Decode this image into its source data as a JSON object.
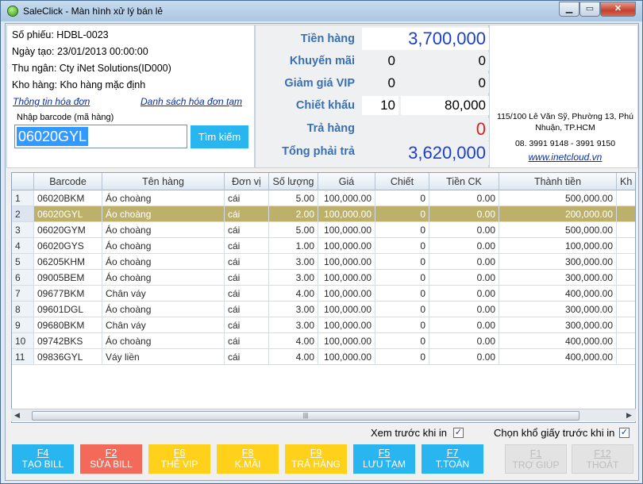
{
  "window": {
    "title": "SaleClick - Màn hình xử lý bán lẻ",
    "min_label": "▁",
    "max_label": "▭",
    "close_label": "✕"
  },
  "info": {
    "so_phieu": "Số phiếu: HDBL-0023",
    "ngay_tao": "Ngày tạo: 23/01/2013 00:00:00",
    "thu_ngan": "Thu ngân: Cty iNet Solutions(ID000)",
    "kho_hang": "Kho hàng: Kho hàng mặc định",
    "link_thong_tin": "Thông tin hóa đơn",
    "link_danh_sach": "Danh sách hóa đơn tạm",
    "barcode_label": "Nhập barcode (mã hàng)",
    "barcode_value": "06020GYL",
    "search_label": "Tìm kiếm"
  },
  "totals": {
    "tien_hang_label": "Tiền hàng",
    "tien_hang_value": "3,700,000",
    "khuyen_mai_label": "Khuyến mãi",
    "khuyen_mai_pct": "0",
    "khuyen_mai_value": "0",
    "giam_gia_label": "Giảm giá VIP",
    "giam_gia_pct": "0",
    "giam_gia_value": "0",
    "chiet_khau_label": "Chiết khấu",
    "chiet_khau_pct": "10",
    "chiet_khau_value": "80,000",
    "tra_hang_label": "Trả hàng",
    "tra_hang_value": "0",
    "tong_label": "Tổng phải trả",
    "tong_value": "3,620,000"
  },
  "contact": {
    "address": "115/100 Lê Văn Sỹ, Phường 13, Phú Nhuận, TP.HCM",
    "phone": "08. 3991 9148 - 3991 9150",
    "website": "www.inetcloud.vn"
  },
  "colors": {
    "accent": "#29b6f0",
    "selected_row": "#bdb06b",
    "red_button": "#f36a5a",
    "yellow_button": "#ffd11a"
  },
  "grid": {
    "headers": [
      "Barcode",
      "Tên hàng",
      "Đơn vị",
      "Số lượng",
      "Giá",
      "Chiết",
      "Tiền CK",
      "Thành tiền",
      "Kh"
    ],
    "selected_index": 1,
    "rows": [
      {
        "n": "1",
        "barcode": "06020BKM",
        "ten": "Áo choàng",
        "dv": "cái",
        "sl": "5.00",
        "gia": "100,000.00",
        "chiet": "0",
        "tien_ck": "0.00",
        "thanh_tien": "500,000.00"
      },
      {
        "n": "2",
        "barcode": "06020GYL",
        "ten": "Áo choàng",
        "dv": "cái",
        "sl": "2.00",
        "gia": "100,000.00",
        "chiet": "0",
        "tien_ck": "0.00",
        "thanh_tien": "200,000.00"
      },
      {
        "n": "3",
        "barcode": "06020GYM",
        "ten": "Áo choàng",
        "dv": "cái",
        "sl": "5.00",
        "gia": "100,000.00",
        "chiet": "0",
        "tien_ck": "0.00",
        "thanh_tien": "500,000.00"
      },
      {
        "n": "4",
        "barcode": "06020GYS",
        "ten": "Áo choàng",
        "dv": "cái",
        "sl": "1.00",
        "gia": "100,000.00",
        "chiet": "0",
        "tien_ck": "0.00",
        "thanh_tien": "100,000.00"
      },
      {
        "n": "5",
        "barcode": "06205KHM",
        "ten": "Áo choàng",
        "dv": "cái",
        "sl": "3.00",
        "gia": "100,000.00",
        "chiet": "0",
        "tien_ck": "0.00",
        "thanh_tien": "300,000.00"
      },
      {
        "n": "6",
        "barcode": "09005BEM",
        "ten": "Áo choàng",
        "dv": "cái",
        "sl": "3.00",
        "gia": "100,000.00",
        "chiet": "0",
        "tien_ck": "0.00",
        "thanh_tien": "300,000.00"
      },
      {
        "n": "7",
        "barcode": "09677BKM",
        "ten": "Chân váy",
        "dv": "cái",
        "sl": "4.00",
        "gia": "100,000.00",
        "chiet": "0",
        "tien_ck": "0.00",
        "thanh_tien": "400,000.00"
      },
      {
        "n": "8",
        "barcode": "09601DGL",
        "ten": "Áo choàng",
        "dv": "cái",
        "sl": "3.00",
        "gia": "100,000.00",
        "chiet": "0",
        "tien_ck": "0.00",
        "thanh_tien": "300,000.00"
      },
      {
        "n": "9",
        "barcode": "09680BKM",
        "ten": "Chân váy",
        "dv": "cái",
        "sl": "3.00",
        "gia": "100,000.00",
        "chiet": "0",
        "tien_ck": "0.00",
        "thanh_tien": "300,000.00"
      },
      {
        "n": "10",
        "barcode": "09742BKS",
        "ten": "Áo choàng",
        "dv": "cái",
        "sl": "4.00",
        "gia": "100,000.00",
        "chiet": "0",
        "tien_ck": "0.00",
        "thanh_tien": "400,000.00"
      },
      {
        "n": "11",
        "barcode": "09836GYL",
        "ten": "Váy liền",
        "dv": "cái",
        "sl": "4.00",
        "gia": "100,000.00",
        "chiet": "0",
        "tien_ck": "0.00",
        "thanh_tien": "400,000.00"
      }
    ]
  },
  "options": {
    "xem_truoc": "Xem trước khi in",
    "chon_kho": "Chọn khổ giấy trước khi in"
  },
  "buttons": [
    {
      "key": "F4",
      "label": "TẠO BILL",
      "color": "#29b6f0",
      "enabled": true
    },
    {
      "key": "F2",
      "label": "SỬA BILL",
      "color": "#f36a5a",
      "enabled": true
    },
    {
      "key": "F6",
      "label": "THẺ VIP",
      "color": "#ffd11a",
      "enabled": true
    },
    {
      "key": "F8",
      "label": "K.MÃI",
      "color": "#ffd11a",
      "enabled": true
    },
    {
      "key": "F9",
      "label": "TRẢ HÀNG",
      "color": "#ffd11a",
      "enabled": true
    },
    {
      "key": "F5",
      "label": "LƯU TẠM",
      "color": "#29b6f0",
      "enabled": true
    },
    {
      "key": "F7",
      "label": "T.TOÁN",
      "color": "#29b6f0",
      "enabled": true
    },
    {
      "key": "F1",
      "label": "TRỢ GIÚP",
      "color": "#e3e3e3",
      "enabled": false
    },
    {
      "key": "F12",
      "label": "THOÁT",
      "color": "#e3e3e3",
      "enabled": false
    }
  ]
}
